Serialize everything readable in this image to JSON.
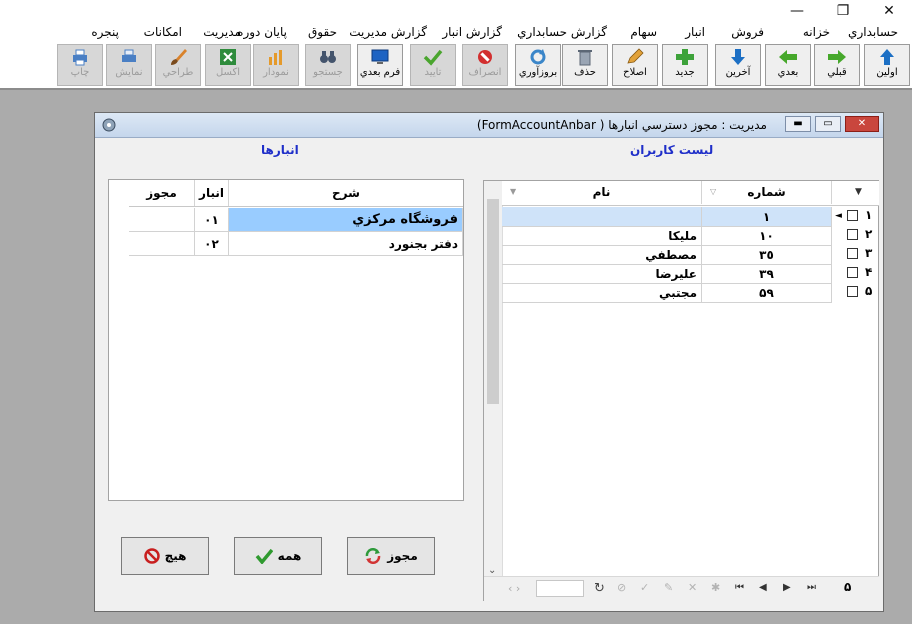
{
  "window_controls": {
    "minimize": "—",
    "restore": "❐",
    "close": "✕"
  },
  "menu": [
    "حسابداري",
    "خزانه",
    "فروش",
    "انبار",
    "سهام",
    "گزارش حسابداري",
    "گزارش انبار",
    "گزارش مديريت",
    "حقوق",
    "پايان دوره",
    "مديريت",
    "امكانات",
    "پنجره"
  ],
  "toolbar": {
    "first": "اولين",
    "prev": "قبلي",
    "next": "بعدي",
    "last": "آخرين",
    "new": "جديد",
    "edit": "اصلاح",
    "delete": "حذف",
    "refresh": "بروزآوري",
    "cancel": "انصراف",
    "confirm": "تاييد",
    "next_form": "فرم بعدي",
    "search": "جستجو",
    "chart": "نمودار",
    "excel": "اكسل",
    "design": "طراحي",
    "preview": "نمايش",
    "print": "چاپ"
  },
  "form": {
    "title": "مديريت : مجوز دسترسي انبارها ( FormAccountAnbar)",
    "users_header": "ليست كاربران",
    "stores_header": "انبارها",
    "users_grid": {
      "columns": {
        "number": "شماره",
        "name": "نام"
      },
      "rows": [
        {
          "row": "١",
          "number": "١",
          "name": ""
        },
        {
          "row": "٢",
          "number": "١٠",
          "name": "مليكا"
        },
        {
          "row": "٣",
          "number": "٣٥",
          "name": "مصطفي"
        },
        {
          "row": "۴",
          "number": "٣٩",
          "name": "عليرضا"
        },
        {
          "row": "۵",
          "number": "۵٩",
          "name": "مجتبي"
        }
      ],
      "record_count": "۵"
    },
    "stores_grid": {
      "columns": {
        "desc": "شرح",
        "store": "انبار",
        "permit": "مجوز"
      },
      "rows": [
        {
          "desc": "فروشگاه مركزي",
          "store": "٠١",
          "permit": ""
        },
        {
          "desc": "دفتر بجنورد",
          "store": "٠٢",
          "permit": ""
        }
      ]
    },
    "buttons": {
      "permit": "مجوز",
      "all": "همه",
      "none": "هيچ"
    }
  },
  "colors": {
    "selected_row": "#99ccff",
    "header_text": "#1f2fc9",
    "current_row": "#cfe3f9"
  }
}
